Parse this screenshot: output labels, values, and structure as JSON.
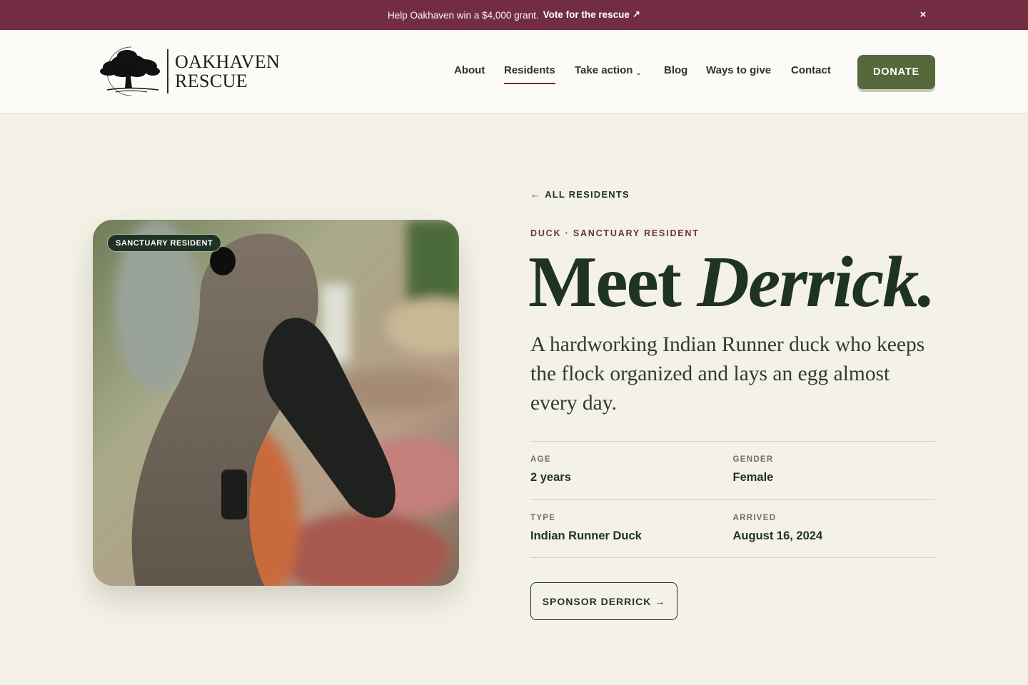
{
  "announcement": {
    "message": "Help Oakhaven win a $4,000 grant.",
    "cta": "Vote for the rescue ↗",
    "close": "×"
  },
  "brand": {
    "line1": "OAKHAVEN",
    "line2": "RESCUE",
    "logo_icon": "oak-tree-icon"
  },
  "nav": {
    "items": [
      {
        "label": "About"
      },
      {
        "label": "Residents",
        "active": true
      },
      {
        "label": "Take action",
        "has_dropdown": true,
        "chevron": "⌄"
      },
      {
        "label": "Blog"
      },
      {
        "label": "Ways to give"
      },
      {
        "label": "Contact"
      }
    ],
    "donate": "DONATE"
  },
  "resident": {
    "back_link": "ALL RESIDENTS",
    "back_arrow": "←",
    "eyebrow": "DUCK · SANCTUARY RESIDENT",
    "title_prefix": "Meet",
    "title_name": "Derrick.",
    "description": "A hardworking Indian Runner duck who keeps the flock organized and lays an egg almost every day.",
    "badge": "SANCTUARY RESIDENT",
    "facts": [
      {
        "label": "AGE",
        "value": "2 years"
      },
      {
        "label": "GENDER",
        "value": "Female"
      },
      {
        "label": "TYPE",
        "value": "Indian Runner Duck"
      },
      {
        "label": "ARRIVED",
        "value": "August 16, 2024"
      }
    ],
    "sponsor_button": "SPONSOR DERRICK →"
  },
  "colors": {
    "announcement_bg": "#722d43",
    "primary_green": "#1f3324",
    "donate_bg": "#56693c",
    "page_bg": "#f4f1e7",
    "header_bg": "#fdfbf8",
    "accent": "#722d43"
  }
}
